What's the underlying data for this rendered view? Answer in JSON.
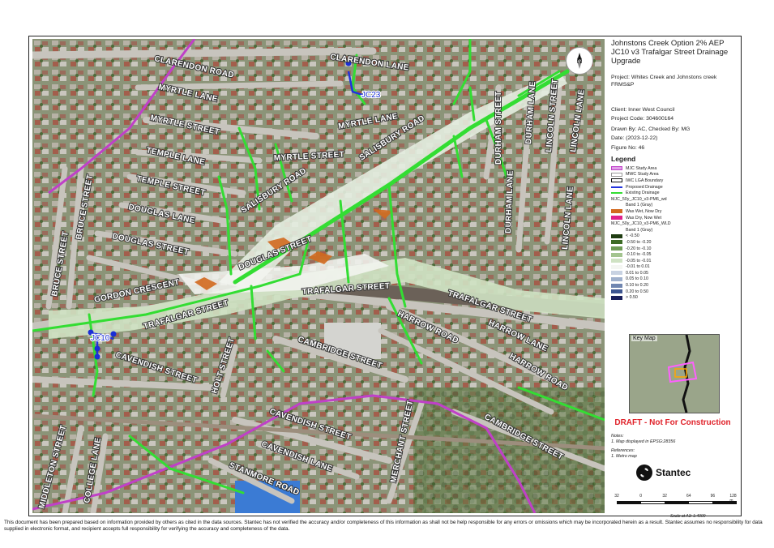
{
  "title": {
    "line1": "Johnstons Creek Option 2% AEP",
    "line2": "JC10 v3 Trafalgar Street Drainage",
    "line3": "Upgrade"
  },
  "north_arrow": {
    "letter": "N",
    "icon": "north-arrow-icon"
  },
  "meta": {
    "project": "Project:  Whites  Creek  and  Johnstons creek FRMS&P",
    "client": "Client:  Inner West Council",
    "project_code": "Project Code:  304600164",
    "drawn_by": "Drawn By:  AC, Checked By: MG",
    "date": "Date:  (2023-12-22)",
    "figure": "Figure No:  46"
  },
  "legend": {
    "title": "Legend",
    "items": [
      {
        "label": "MJC Study Area",
        "type": "box",
        "color": "#e0a0e8",
        "border": "#c040c8"
      },
      {
        "label": "MWC Study Area",
        "type": "box",
        "color": "#ffffff",
        "border": "#999999"
      },
      {
        "label": "IWC LGA Boundary",
        "type": "box",
        "color": "#ffffff",
        "border": "#111111"
      },
      {
        "label": "Proposed Drainage",
        "type": "line",
        "color": "#2233dd"
      },
      {
        "label": "Existing Drainage",
        "type": "line",
        "color": "#33dd33"
      },
      {
        "label": "MJC_50y_JC10_v3-PM6_wd",
        "type": "text"
      },
      {
        "label": "Band 1 (Gray)",
        "type": "indent"
      },
      {
        "label": "Was Wet, Now Dry",
        "type": "fill",
        "color": "#d2691e"
      },
      {
        "label": "Was Dry, Now Wet",
        "type": "fill",
        "color": "#e0208a"
      },
      {
        "label": "MJC_50y_JC10_v3-PM6_WLD",
        "type": "text"
      },
      {
        "label": "Band 1 (Gray)",
        "type": "indent"
      },
      {
        "label": "< -0.50",
        "type": "fill",
        "color": "#1f3d12"
      },
      {
        "label": "-0.50 to -0.20",
        "type": "fill",
        "color": "#3d6b25"
      },
      {
        "label": "-0.20 to -0.10",
        "type": "fill",
        "color": "#6e9b55"
      },
      {
        "label": "-0.10 to -0.05",
        "type": "fill",
        "color": "#a3c48f"
      },
      {
        "label": "-0.05 to -0.01",
        "type": "fill",
        "color": "#cfe2c3"
      },
      {
        "label": "-0.01 to 0.01",
        "type": "fill",
        "color": "#f4f6f2"
      },
      {
        "label": "0.01 to 0.05",
        "type": "fill",
        "color": "#c8d2e2"
      },
      {
        "label": "0.05 to 0.10",
        "type": "fill",
        "color": "#9fb0cc"
      },
      {
        "label": "0.10 to 0.20",
        "type": "fill",
        "color": "#7086b0"
      },
      {
        "label": "0.20 to 0.50",
        "type": "fill",
        "color": "#3d5590"
      },
      {
        "label": "> 0.50",
        "type": "fill",
        "color": "#1a1f5a"
      }
    ]
  },
  "key_map": {
    "label": "Key Map"
  },
  "draft": "DRAFT - Not For Construction",
  "notes": {
    "heading": "Notes:",
    "note1": "1. Map displayed in EPSG:28356",
    "ref_heading": "References:",
    "ref1": "1. Metro map"
  },
  "logo": {
    "text": "Stantec",
    "icon": "stantec-logo-icon"
  },
  "scale": {
    "ticks": [
      "32",
      "0",
      "32",
      "64",
      "96",
      "128 m"
    ],
    "text": "Scale at A3: 1:4000"
  },
  "map": {
    "nodes": [
      "JC23",
      "JC10"
    ],
    "streets": [
      "CLARENDON ROAD",
      "CLARENDON LANE",
      "MYRTLE LANE",
      "MYRTLE STREET",
      "MYRTLE LANE",
      "MYRTLE STREET",
      "SALISBURY ROAD",
      "SALISBURY ROAD",
      "TEMPLE LANE",
      "TEMPLE STREET",
      "DOUGLAS LANE",
      "DOUGLAS STREET",
      "DOUGLAS STREET",
      "BRUCE STREET",
      "BRUCE STREET",
      "GORDON CRESCENT",
      "TRAFALGAR STREET",
      "TRAFALGAR STREET",
      "TRAFALGAR STREET",
      "HARROW ROAD",
      "HARROW LANE",
      "HARROW ROAD",
      "CAMBRIDGE STREET",
      "CAMBRIDGE STREET",
      "CAVENDISH STREET",
      "CAVENDISH STREET",
      "CAVENDISH LANE",
      "HOLT STREET",
      "STANMORE ROAD",
      "MERCHANT STREET",
      "MIDDLETON STREET",
      "COLLEGE LANE",
      "DURHAM STREET",
      "DURHAM LANE",
      "DURHAM LANE",
      "LINCOLN STREET",
      "LINCOLN LANE",
      "LINCOLN LANE"
    ]
  },
  "footer": "This document has been prepared based on information provided by others as cited in the data sources. Stantec has not verified the accuracy and/or completeness of this information as shall not be help responsible for any errors or omissions which may be incorporated herein as a result. Stantec assumes no responsibility for data supplied in electronic format, and recipient accepts full responsibility for verifying the accuracy and completeness of the data."
}
